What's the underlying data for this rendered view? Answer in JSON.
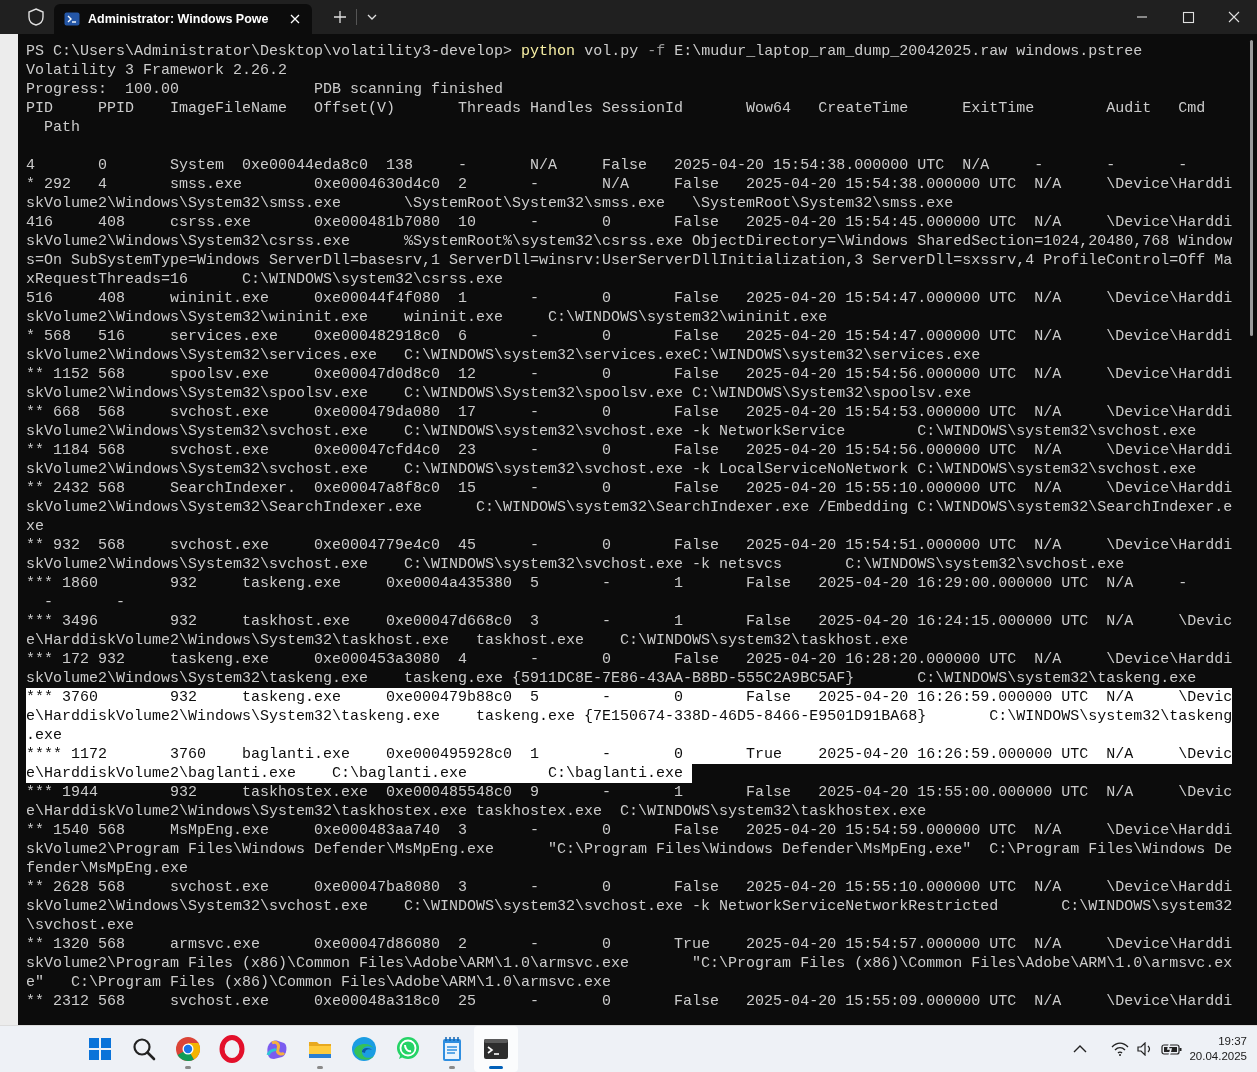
{
  "window": {
    "tabs": [
      {
        "title": "Administrator: Windows Powe",
        "selected": true
      }
    ]
  },
  "terminal": {
    "lines": [
      {
        "kind": "prompt",
        "prompt": "PS C:\\Users\\Administrator\\Desktop\\volatility3-develop>",
        "command": "python",
        "args": [
          {
            "kind": "arg",
            "text": "vol.py"
          },
          {
            "kind": "flag",
            "text": "-f"
          },
          {
            "kind": "arg",
            "text": "E:\\mudur_laptop_ram_dump_20042025.raw windows.pstree"
          }
        ],
        "selected": false
      },
      {
        "kind": "output",
        "text": "Volatility 3 Framework 2.26.2",
        "selected": false
      },
      {
        "kind": "output",
        "text": "Progress:  100.00               PDB scanning finished",
        "selected": false
      },
      {
        "kind": "output",
        "text": "PID     PPID    ImageFileName   Offset(V)       Threads Handles SessionId       Wow64   CreateTime      ExitTime        Audit   Cmd",
        "selected": false
      },
      {
        "kind": "output",
        "text": "  Path",
        "selected": false
      },
      {
        "kind": "blank",
        "selected": false
      },
      {
        "kind": "output",
        "text": "4       0       System  0xe00044eda8c0  138     -       N/A     False   2025-04-20 15:54:38.000000 UTC  N/A     -       -       -",
        "selected": false
      },
      {
        "kind": "output",
        "text": "* 292   4       smss.exe        0xe0004630d4c0  2       -       N/A     False   2025-04-20 15:54:38.000000 UTC  N/A     \\Device\\Harddi",
        "selected": false
      },
      {
        "kind": "output",
        "text": "skVolume2\\Windows\\System32\\smss.exe       \\SystemRoot\\System32\\smss.exe   \\SystemRoot\\System32\\smss.exe",
        "selected": false
      },
      {
        "kind": "output",
        "text": "416     408     csrss.exe       0xe000481b7080  10      -       0       False   2025-04-20 15:54:45.000000 UTC  N/A     \\Device\\Harddi",
        "selected": false
      },
      {
        "kind": "output",
        "text": "skVolume2\\Windows\\System32\\csrss.exe      %SystemRoot%\\system32\\csrss.exe ObjectDirectory=\\Windows SharedSection=1024,20480,768 Window",
        "selected": false
      },
      {
        "kind": "output",
        "text": "s=On SubSystemType=Windows ServerDll=basesrv,1 ServerDll=winsrv:UserServerDllInitialization,3 ServerDll=sxssrv,4 ProfileControl=Off Ma",
        "selected": false
      },
      {
        "kind": "output",
        "text": "xRequestThreads=16      C:\\WINDOWS\\system32\\csrss.exe",
        "selected": false
      },
      {
        "kind": "output",
        "text": "516     408     wininit.exe     0xe00044f4f080  1       -       0       False   2025-04-20 15:54:47.000000 UTC  N/A     \\Device\\Harddi",
        "selected": false
      },
      {
        "kind": "output",
        "text": "skVolume2\\Windows\\System32\\wininit.exe    wininit.exe     C:\\WINDOWS\\system32\\wininit.exe",
        "selected": false
      },
      {
        "kind": "output",
        "text": "* 568   516     services.exe    0xe000482918c0  6       -       0       False   2025-04-20 15:54:47.000000 UTC  N/A     \\Device\\Harddi",
        "selected": false
      },
      {
        "kind": "output",
        "text": "skVolume2\\Windows\\System32\\services.exe   C:\\WINDOWS\\system32\\services.exeC:\\WINDOWS\\system32\\services.exe",
        "selected": false
      },
      {
        "kind": "output",
        "text": "** 1152 568     spoolsv.exe     0xe00047d0d8c0  12      -       0       False   2025-04-20 15:54:56.000000 UTC  N/A     \\Device\\Harddi",
        "selected": false
      },
      {
        "kind": "output",
        "text": "skVolume2\\Windows\\System32\\spoolsv.exe    C:\\WINDOWS\\System32\\spoolsv.exe C:\\WINDOWS\\System32\\spoolsv.exe",
        "selected": false
      },
      {
        "kind": "output",
        "text": "** 668  568     svchost.exe     0xe000479da080  17      -       0       False   2025-04-20 15:54:53.000000 UTC  N/A     \\Device\\Harddi",
        "selected": false
      },
      {
        "kind": "output",
        "text": "skVolume2\\Windows\\System32\\svchost.exe    C:\\WINDOWS\\system32\\svchost.exe -k NetworkService        C:\\WINDOWS\\system32\\svchost.exe",
        "selected": false
      },
      {
        "kind": "output",
        "text": "** 1184 568     svchost.exe     0xe00047cfd4c0  23      -       0       False   2025-04-20 15:54:56.000000 UTC  N/A     \\Device\\Harddi",
        "selected": false
      },
      {
        "kind": "output",
        "text": "skVolume2\\Windows\\System32\\svchost.exe    C:\\WINDOWS\\system32\\svchost.exe -k LocalServiceNoNetwork C:\\WINDOWS\\system32\\svchost.exe",
        "selected": false
      },
      {
        "kind": "output",
        "text": "** 2432 568     SearchIndexer.  0xe00047a8f8c0  15      -       0       False   2025-04-20 15:55:10.000000 UTC  N/A     \\Device\\Harddi",
        "selected": false
      },
      {
        "kind": "output",
        "text": "skVolume2\\Windows\\System32\\SearchIndexer.exe      C:\\WINDOWS\\system32\\SearchIndexer.exe /Embedding C:\\WINDOWS\\system32\\SearchIndexer.e",
        "selected": false
      },
      {
        "kind": "output",
        "text": "xe",
        "selected": false
      },
      {
        "kind": "output",
        "text": "** 932  568     svchost.exe     0xe0004779e4c0  45      -       0       False   2025-04-20 15:54:51.000000 UTC  N/A     \\Device\\Harddi",
        "selected": false
      },
      {
        "kind": "output",
        "text": "skVolume2\\Windows\\System32\\svchost.exe    C:\\WINDOWS\\system32\\svchost.exe -k netsvcs       C:\\WINDOWS\\system32\\svchost.exe",
        "selected": false
      },
      {
        "kind": "output",
        "text": "*** 1860        932     taskeng.exe     0xe0004a435380  5       -       1       False   2025-04-20 16:29:00.000000 UTC  N/A     -",
        "selected": false
      },
      {
        "kind": "output",
        "text": "  -       -",
        "selected": false
      },
      {
        "kind": "output",
        "text": "*** 3496        932     taskhost.exe    0xe00047d668c0  3       -       1       False   2025-04-20 16:24:15.000000 UTC  N/A     \\Devic",
        "selected": false
      },
      {
        "kind": "output",
        "text": "e\\HarddiskVolume2\\Windows\\System32\\taskhost.exe   taskhost.exe    C:\\WINDOWS\\system32\\taskhost.exe",
        "selected": false
      },
      {
        "kind": "output",
        "text": "*** 172 932     taskeng.exe     0xe000453a3080  4       -       0       False   2025-04-20 16:28:20.000000 UTC  N/A     \\Device\\Harddi",
        "selected": false
      },
      {
        "kind": "output",
        "text": "skVolume2\\Windows\\System32\\taskeng.exe    taskeng.exe {5911DC8E-7E86-43AA-B8BD-555C2A9BC5AF}       C:\\WINDOWS\\system32\\taskeng.exe",
        "selected": false
      },
      {
        "kind": "output",
        "text": "*** 3760        932     taskeng.exe     0xe000479b88c0  5       -       0       False   2025-04-20 16:26:59.000000 UTC  N/A     \\Devic",
        "selected": true
      },
      {
        "kind": "output",
        "text": "e\\HarddiskVolume2\\Windows\\System32\\taskeng.exe    taskeng.exe {7E150674-338D-46D5-8466-E9501D91BA68}       C:\\WINDOWS\\system32\\taskeng",
        "selected": true
      },
      {
        "kind": "output",
        "text": ".exe",
        "selected": true
      },
      {
        "kind": "output",
        "text": "**** 1172       3760    baglanti.exe    0xe000495928c0  1       -       0       True    2025-04-20 16:26:59.000000 UTC  N/A     \\Devic",
        "selected": true
      },
      {
        "kind": "output",
        "text": "e\\HarddiskVolume2\\baglanti.exe    C:\\baglanti.exe         C:\\baglanti.exe",
        "selected": true
      },
      {
        "kind": "output",
        "text": "*** 1944        932     taskhostex.exe  0xe000485548c0  9       -       1       False   2025-04-20 15:55:00.000000 UTC  N/A     \\Devic",
        "selected": false
      },
      {
        "kind": "output",
        "text": "e\\HarddiskVolume2\\Windows\\System32\\taskhostex.exe taskhostex.exe  C:\\WINDOWS\\system32\\taskhostex.exe",
        "selected": false
      },
      {
        "kind": "output",
        "text": "** 1540 568     MsMpEng.exe     0xe000483aa740  3       -       0       False   2025-04-20 15:54:59.000000 UTC  N/A     \\Device\\Harddi",
        "selected": false
      },
      {
        "kind": "output",
        "text": "skVolume2\\Program Files\\Windows Defender\\MsMpEng.exe      \"C:\\Program Files\\Windows Defender\\MsMpEng.exe\"  C:\\Program Files\\Windows De",
        "selected": false
      },
      {
        "kind": "output",
        "text": "fender\\MsMpEng.exe",
        "selected": false
      },
      {
        "kind": "output",
        "text": "** 2628 568     svchost.exe     0xe00047ba8080  3       -       0       False   2025-04-20 15:55:10.000000 UTC  N/A     \\Device\\Harddi",
        "selected": false
      },
      {
        "kind": "output",
        "text": "skVolume2\\Windows\\System32\\svchost.exe    C:\\WINDOWS\\system32\\svchost.exe -k NetworkServiceNetworkRestricted       C:\\WINDOWS\\system32",
        "selected": false
      },
      {
        "kind": "output",
        "text": "\\svchost.exe",
        "selected": false
      },
      {
        "kind": "output",
        "text": "** 1320 568     armsvc.exe      0xe00047d86080  2       -       0       True    2025-04-20 15:54:57.000000 UTC  N/A     \\Device\\Harddi",
        "selected": false
      },
      {
        "kind": "output",
        "text": "skVolume2\\Program Files (x86)\\Common Files\\Adobe\\ARM\\1.0\\armsvc.exe       \"C:\\Program Files (x86)\\Common Files\\Adobe\\ARM\\1.0\\armsvc.ex",
        "selected": false
      },
      {
        "kind": "output",
        "text": "e\"   C:\\Program Files (x86)\\Common Files\\Adobe\\ARM\\1.0\\armsvc.exe",
        "selected": false
      },
      {
        "kind": "output",
        "text": "** 2312 568     svchost.exe     0xe00048a318c0  25      -       0       False   2025-04-20 15:55:09.000000 UTC  N/A     \\Device\\Harddi",
        "selected": false
      }
    ]
  },
  "taskbar": {
    "apps": [
      {
        "kind": "start",
        "running": false,
        "active": false
      },
      {
        "kind": "search",
        "running": false,
        "active": false
      },
      {
        "kind": "chrome",
        "running": true,
        "active": false
      },
      {
        "kind": "opera",
        "running": false,
        "active": false
      },
      {
        "kind": "copilot",
        "running": false,
        "active": false
      },
      {
        "kind": "explorer",
        "running": true,
        "active": false
      },
      {
        "kind": "edge",
        "running": false,
        "active": false
      },
      {
        "kind": "whatsapp",
        "running": false,
        "active": false
      },
      {
        "kind": "notepad",
        "running": true,
        "active": false
      },
      {
        "kind": "terminal",
        "running": true,
        "active": true
      }
    ],
    "clock": {
      "time": "19:37",
      "date": "20.04.2025"
    }
  }
}
